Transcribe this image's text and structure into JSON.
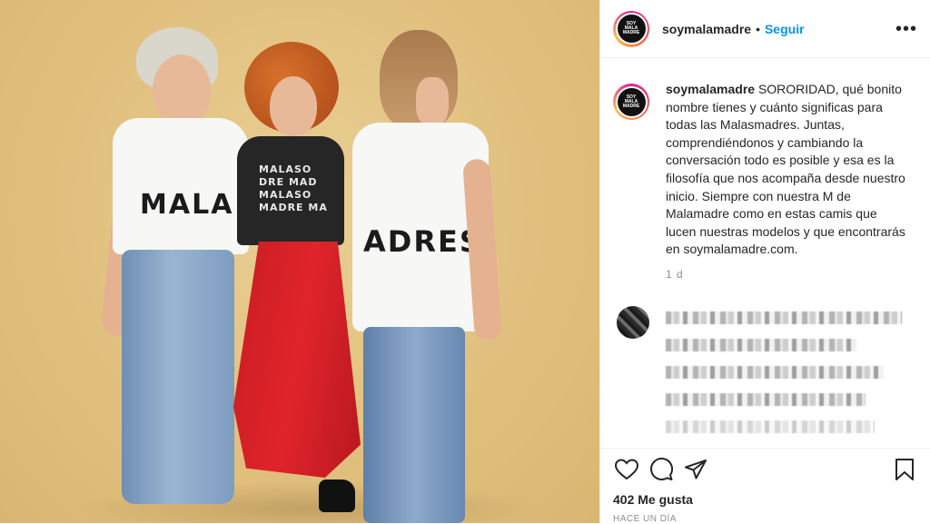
{
  "post": {
    "username": "soymalamadre",
    "separator": "•",
    "follow_label": "Seguir",
    "more_label": "•••",
    "avatar_text": "SOY MALA MADRE",
    "caption_username": "soymalamadre",
    "caption_text": "SORORIDAD, qué bonito nombre tienes y cuánto significas para todas las Malasmadres. Juntas, comprendiéndonos y cambiando la conversación todo es posible y esa es la filosofía que nos acompaña desde nuestro inicio. Siempre con nuestra M de Malamadre como en estas camis que lucen nuestras modelos y que encontrarás en soymalamadre.com.",
    "caption_time": "1 d",
    "likes_text": "402 Me gusta",
    "posted_ago": "HACE UN DÍA"
  },
  "photo": {
    "tee_left": "MALA",
    "tee_middle": "MALASO DRE MAD MALASO MADRE MA",
    "tee_right": "ADRES"
  },
  "icons": {
    "like": "heart-icon",
    "comment": "comment-icon",
    "share": "share-icon",
    "save": "bookmark-icon"
  },
  "colors": {
    "background": "#e1c07e",
    "accent_blue": "#0095f6",
    "skirt_red": "#e0242b"
  }
}
